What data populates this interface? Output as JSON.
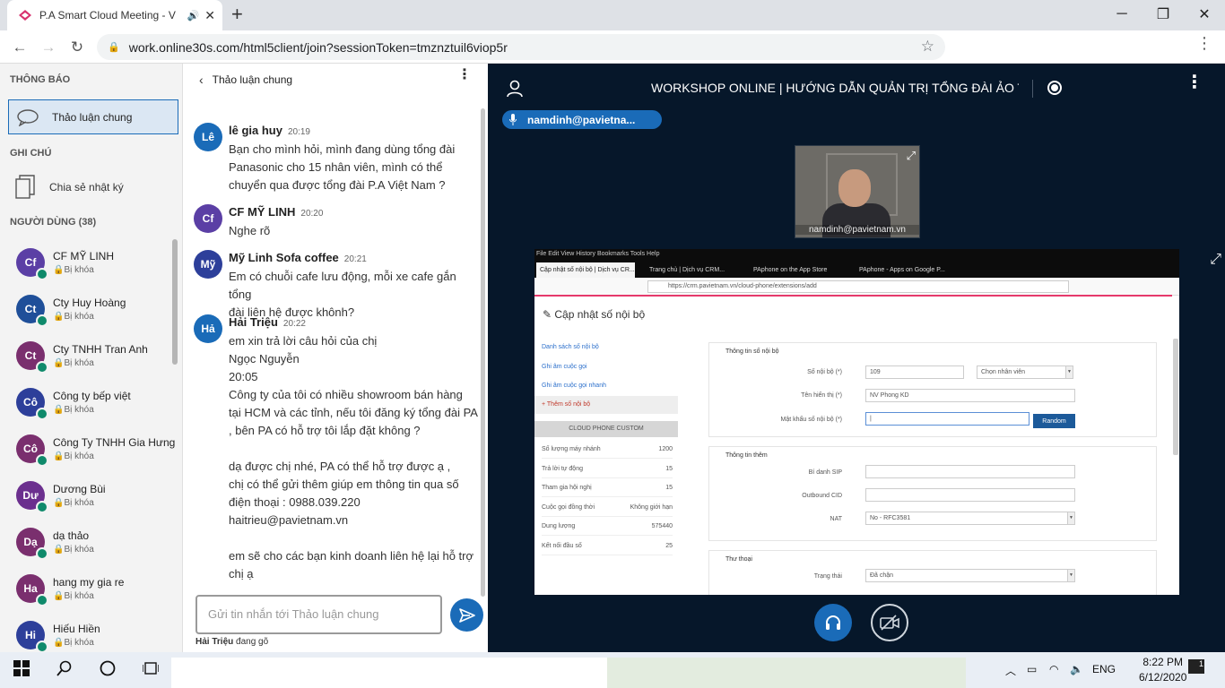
{
  "browser": {
    "tab_title": "P.A Smart Cloud Meeting - V",
    "url": "work.online30s.com/html5client/join?sessionToken=tmznztuil6viop5r"
  },
  "sidebar": {
    "notifications_title": "THÔNG BÁO",
    "public_chat": "Thảo luận chung",
    "notes_title": "GHI CHÚ",
    "shared_notes": "Chia sẻ nhật ký",
    "users_title": "NGƯỜI DÙNG (38)",
    "users": [
      {
        "initials": "Cf",
        "name": "CF MỸ LINH",
        "status": "Bị khóa",
        "color": "#5b3fa5"
      },
      {
        "initials": "Ct",
        "name": "Cty Huy Hoàng",
        "status": "Bị khóa",
        "color": "#1f4f99"
      },
      {
        "initials": "Ct",
        "name": "Cty TNHH Tran Anh",
        "status": "Bị khóa",
        "color": "#7a2f6e"
      },
      {
        "initials": "Cô",
        "name": "Công ty bếp việt",
        "status": "Bị khóa",
        "color": "#2d3f9a"
      },
      {
        "initials": "Cô",
        "name": "Công Ty TNHH Gia Hưng",
        "status": "Bị khóa",
        "color": "#7a2f6e"
      },
      {
        "initials": "Dư",
        "name": "Dương Bùi",
        "status": "Bị khóa",
        "color": "#6b2f8e"
      },
      {
        "initials": "Dạ",
        "name": "dạ thảo",
        "status": "Bị khóa",
        "color": "#7a2f6e"
      },
      {
        "initials": "Ha",
        "name": "hang my gia re",
        "status": "Bị khóa",
        "color": "#7a2f6e"
      },
      {
        "initials": "Hi",
        "name": "Hiếu Hiền",
        "status": "Bị khóa",
        "color": "#2d3f9a"
      }
    ]
  },
  "chat": {
    "header": "Thảo luận chung",
    "messages": [
      {
        "initials": "Lê",
        "name": "lê gia huy",
        "time": "20:19",
        "color": "#1a6bb8",
        "text": "Bạn cho mình hỏi, mình đang dùng tổng đài\nPanasonic cho 15 nhân viên, mình có thể\nchuyển qua được tổng đài P.A Việt Nam ?"
      },
      {
        "initials": "Cf",
        "name": "CF MỸ LINH",
        "time": "20:20",
        "color": "#5b3fa5",
        "text": "Nghe rõ"
      },
      {
        "initials": "Mỹ",
        "name": "Mỹ Linh Sofa coffee",
        "time": "20:21",
        "color": "#2d3f9a",
        "text": "Em có chuỗi cafe lưu động, mỗi xe cafe gắn tổng\nđài liên hệ được khônh?"
      },
      {
        "initials": "Hả",
        "name": "Hải Triệu",
        "time": "20:22",
        "color": "#1a6bb8",
        "text": "em xin trả lời câu hỏi của chị\nNgọc Nguyễn\n20:05\nCông ty của tôi có nhiều showroom bán hàng\ntại HCM và các tỉnh, nếu tôi đăng ký tổng đài PA\n, bên PA có hỗ trợ tôi lắp đặt không ?\n\ndạ được chị nhé, PA có thể hỗ trợ được ạ ,\nchị có thể gửi thêm giúp em thông tin qua số\nđiện thoại : 0988.039.220\nhaitrieu@pavietnam.vn\n\nem sẽ cho các bạn kinh doanh liên hệ lại hỗ trợ\nchị ạ"
      }
    ],
    "input_placeholder": "Gửi tin nhắn tới Thảo luận chung",
    "typing_name": "Hải Triệu",
    "typing_suffix": " đang gõ"
  },
  "meeting": {
    "title": "WORKSHOP ONLINE | HƯỚNG DẪN QUẢN TRỊ TỔNG ĐÀI ẢO THÔNG MI...",
    "talker": "namdinh@pavietna...",
    "webcam_name": "namdinh@pavietnam.vn"
  },
  "shared_screen": {
    "menu": "File   Edit   View   History   Bookmarks   Tools   Help",
    "tabs": [
      "Cập nhật số nội bộ | Dịch vụ CR...",
      "Trang chủ | Dịch vụ CRM...",
      "PAphone on the App Store",
      "PAphone - Apps on Google P..."
    ],
    "url": "https://crm.pavietnam.vn/cloud-phone/extensions/add",
    "heading": "Cập nhật số nội bộ",
    "left_links": [
      "Danh sách số nội bộ",
      "Ghi âm cuộc gọi",
      "Ghi âm cuộc gọi nhanh",
      "+ Thêm số nội bộ"
    ],
    "cloud_title": "CLOUD PHONE CUSTOM",
    "stats": [
      {
        "label": "Số lượng máy nhánh",
        "value": "1200"
      },
      {
        "label": "Trả lời tự động",
        "value": "15"
      },
      {
        "label": "Tham gia hội nghị",
        "value": "15"
      },
      {
        "label": "Cuộc gọi đồng thời",
        "value": "Không giới hạn"
      },
      {
        "label": "Dung lượng",
        "value": "575440"
      },
      {
        "label": "Kết nối đầu số",
        "value": "25"
      }
    ],
    "box1_title": "Thông tin số nội bộ",
    "ext_label": "Số nội bộ (*)",
    "ext_value": "109",
    "staff_select": "Chọn nhân viên",
    "display_label": "Tên hiển thị (*)",
    "display_value": "NV Phong KD",
    "pass_label": "Mật khẩu số nội bộ (*)",
    "random_btn": "Random",
    "box2_title": "Thông tin thêm",
    "sip_label": "Bí danh SIP",
    "cid_label": "Outbound CID",
    "nat_label": "NAT",
    "nat_value": "No - RFC3581",
    "box3_title": "Thư thoại",
    "status_label": "Trạng thái",
    "status_value": "Đã chặn"
  },
  "taskbar": {
    "lang": "ENG",
    "time": "8:22 PM",
    "date": "6/12/2020",
    "notif_count": "1"
  }
}
